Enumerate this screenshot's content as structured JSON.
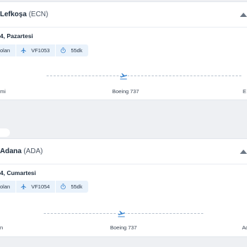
{
  "flights": [
    {
      "route_city": "Lefkoşa",
      "route_code": "(ECN)",
      "date": "4, Pazartesi",
      "carrier": "olan",
      "flight_no": "VF1053",
      "duration": "55dk",
      "origin": "mi",
      "aircraft": "Boeing 737",
      "destination": "E"
    },
    {
      "route_city": "Adana",
      "route_code": "(ADA)",
      "date": "4, Cumartesi",
      "carrier": "olan",
      "flight_no": "VF1054",
      "duration": "55dk",
      "origin": "n",
      "aircraft": "Boeing 737",
      "destination": "Ad"
    }
  ],
  "colors": {
    "accent": "#3d86cf",
    "chip_bg": "#e9f2fb",
    "background": "#eef0f3"
  },
  "icons": [
    "plane-icon",
    "stopwatch-icon",
    "chevron-up-icon"
  ]
}
